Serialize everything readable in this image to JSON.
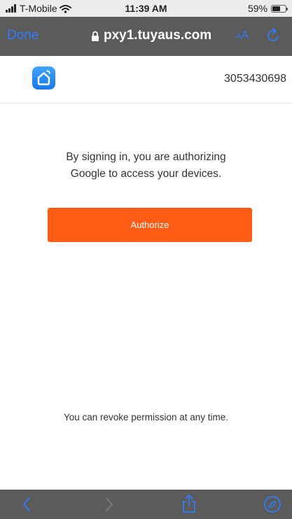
{
  "status_bar": {
    "carrier": "T-Mobile",
    "time": "11:39 AM",
    "battery_percent": "59%",
    "battery_level": 0.59,
    "icons": [
      "signal-icon",
      "wifi-icon",
      "battery-icon"
    ]
  },
  "browser": {
    "done_label": "Done",
    "url": "pxy1.tuyaus.com",
    "text_size_label_small": "A",
    "text_size_label_large": "A",
    "icons": [
      "lock-icon",
      "reload-icon",
      "back-icon",
      "forward-icon",
      "share-icon",
      "compass-icon"
    ],
    "accent_color": "#2f7cf6",
    "bar_color": "#5b5b5b"
  },
  "header": {
    "logo_icon": "smart-home-icon",
    "account_id": "3053430698"
  },
  "main": {
    "message_line1": "By signing in, you are authorizing",
    "message_line2": "Google to access your devices.",
    "authorize_label": "Authorize",
    "authorize_color": "#ff5c15",
    "revoke_message": "You can revoke permission at any time."
  }
}
